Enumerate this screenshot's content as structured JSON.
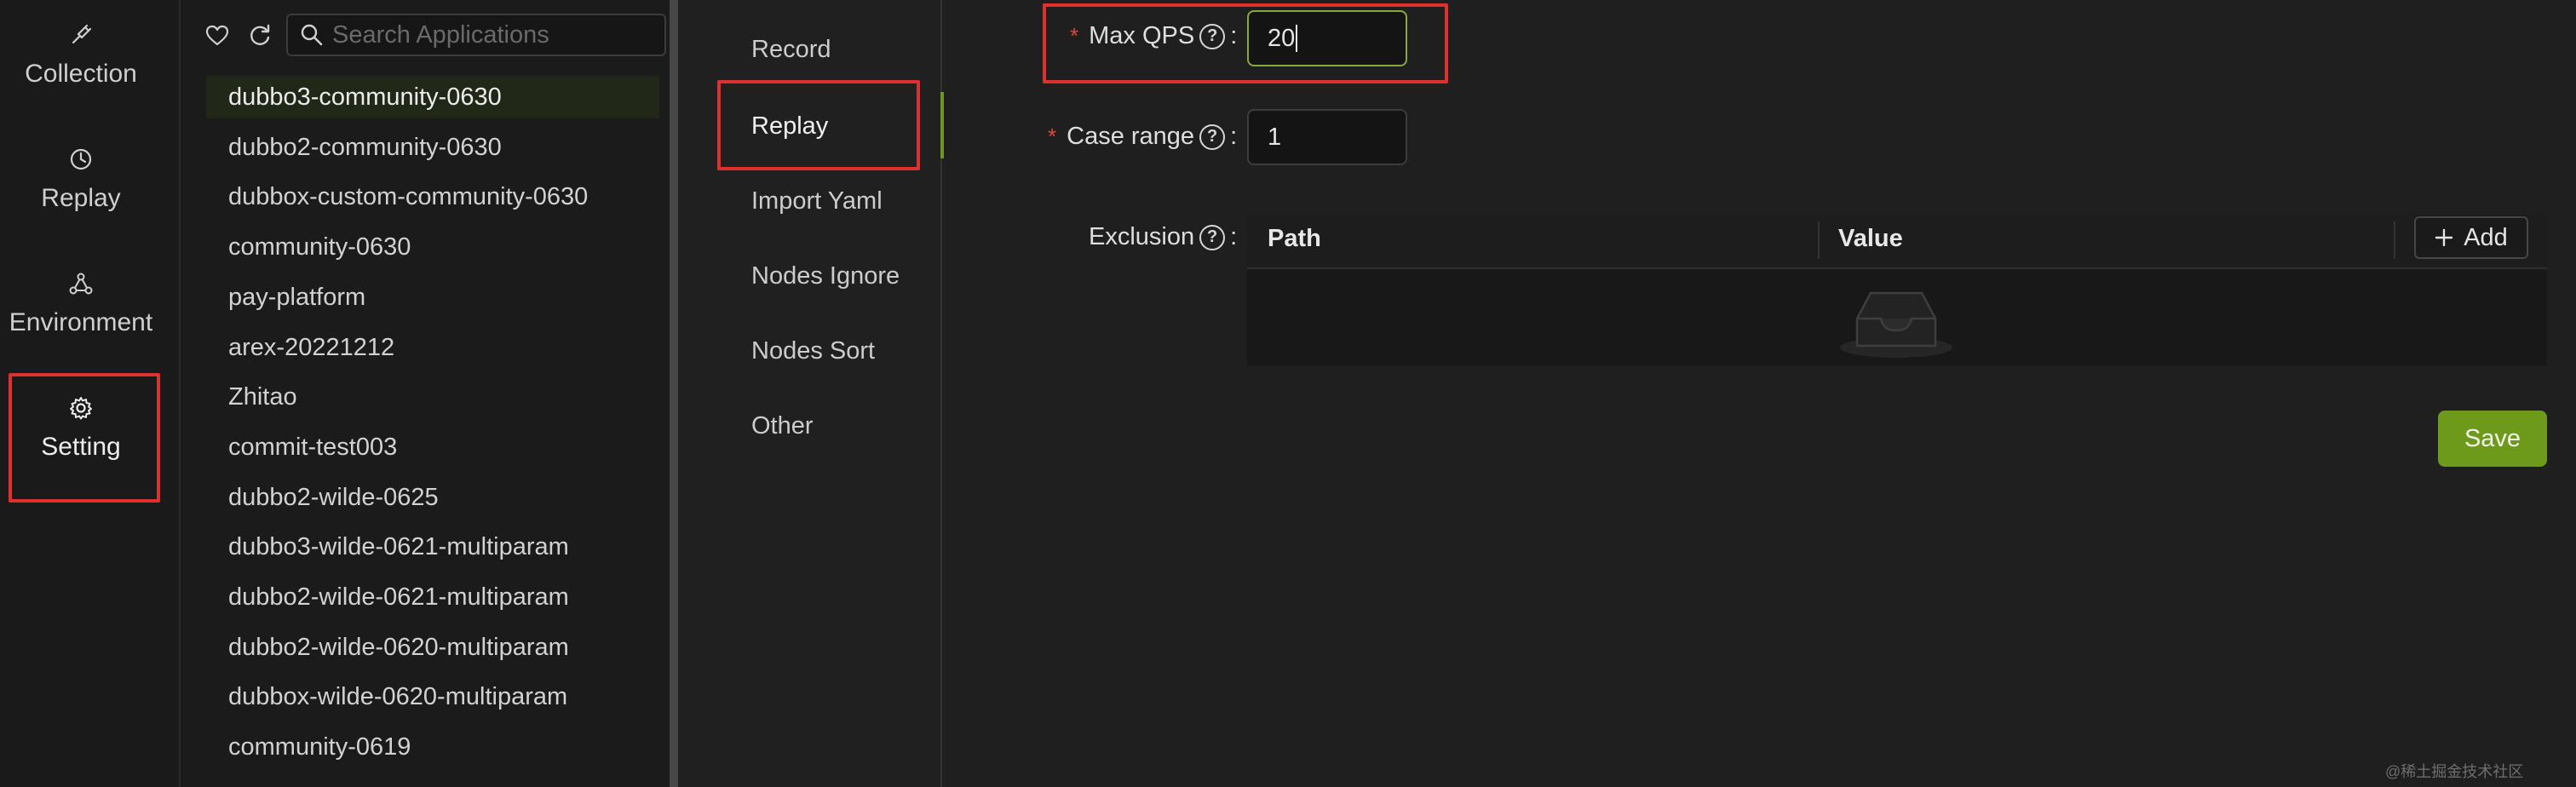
{
  "rail": {
    "items": [
      {
        "label": "Collection",
        "icon": "plug-icon"
      },
      {
        "label": "Replay",
        "icon": "clock-icon"
      },
      {
        "label": "Environment",
        "icon": "nodes-icon"
      },
      {
        "label": "Setting",
        "icon": "gear-icon"
      }
    ]
  },
  "apps": {
    "search_placeholder": "Search Applications",
    "items": [
      "dubbo3-community-0630",
      "dubbo2-community-0630",
      "dubbox-custom-community-0630",
      "community-0630",
      "pay-platform",
      "arex-20221212",
      "Zhitao",
      "commit-test003",
      "dubbo2-wilde-0625",
      "dubbo3-wilde-0621-multiparam",
      "dubbo2-wilde-0621-multiparam",
      "dubbo2-wilde-0620-multiparam",
      "dubbox-wilde-0620-multiparam",
      "community-0619"
    ]
  },
  "menu": {
    "items": [
      "Record",
      "Replay",
      "Import Yaml",
      "Nodes Ignore",
      "Nodes Sort",
      "Other"
    ]
  },
  "form": {
    "max_qps_label": "Max QPS",
    "max_qps_value": "20",
    "case_range_label": "Case range",
    "case_range_value": "1",
    "exclusion_label": "Exclusion",
    "col_path": "Path",
    "col_value": "Value",
    "add_label": "Add",
    "save_label": "Save",
    "colon": ":"
  },
  "watermark": "@稀土掘金技术社区",
  "colors": {
    "accent": "#6e9a1c",
    "highlight": "#e0302b",
    "background": "#1f1f1f"
  }
}
